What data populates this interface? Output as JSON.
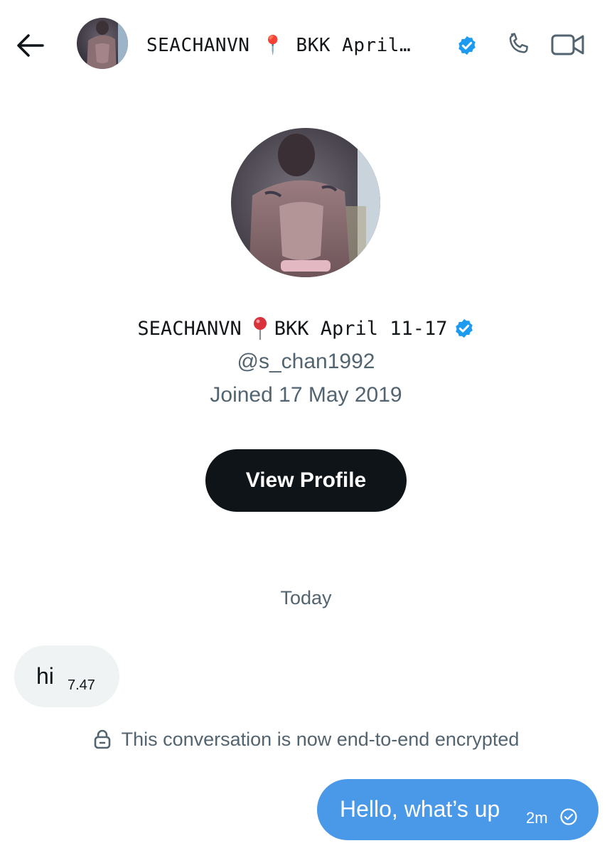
{
  "header": {
    "name": "SEACHANVN 📍 BKK April…",
    "back_label": "Back",
    "icons": {
      "back": "arrow-left-icon",
      "pin": "round-pushpin-icon",
      "verified": "verified-badge-icon",
      "call": "phone-icon",
      "video": "video-camera-icon"
    }
  },
  "profile": {
    "display_name": "SEACHANVN",
    "name_suffix": "BKK April 11-17",
    "handle": "@s_chan1992",
    "joined": "Joined 17 May 2019",
    "view_profile_label": "View Profile"
  },
  "conversation": {
    "day_separator": "Today",
    "messages": [
      {
        "direction": "incoming",
        "text": "hi",
        "time": "7.47"
      },
      {
        "direction": "outgoing",
        "text": "Hello, what’s up",
        "time": "2m",
        "status_icon": "seen-check-icon"
      }
    ],
    "encryption_notice": "This conversation is now end-to-end encrypted",
    "encryption_icon": "lock-icon"
  },
  "colors": {
    "verified": "#1d9bf0",
    "outgoing_bubble": "#4a99e9",
    "incoming_bubble": "#eff3f4",
    "primary_button": "#0f1419",
    "secondary_text": "#536471",
    "pin_red": "#d9323c"
  }
}
